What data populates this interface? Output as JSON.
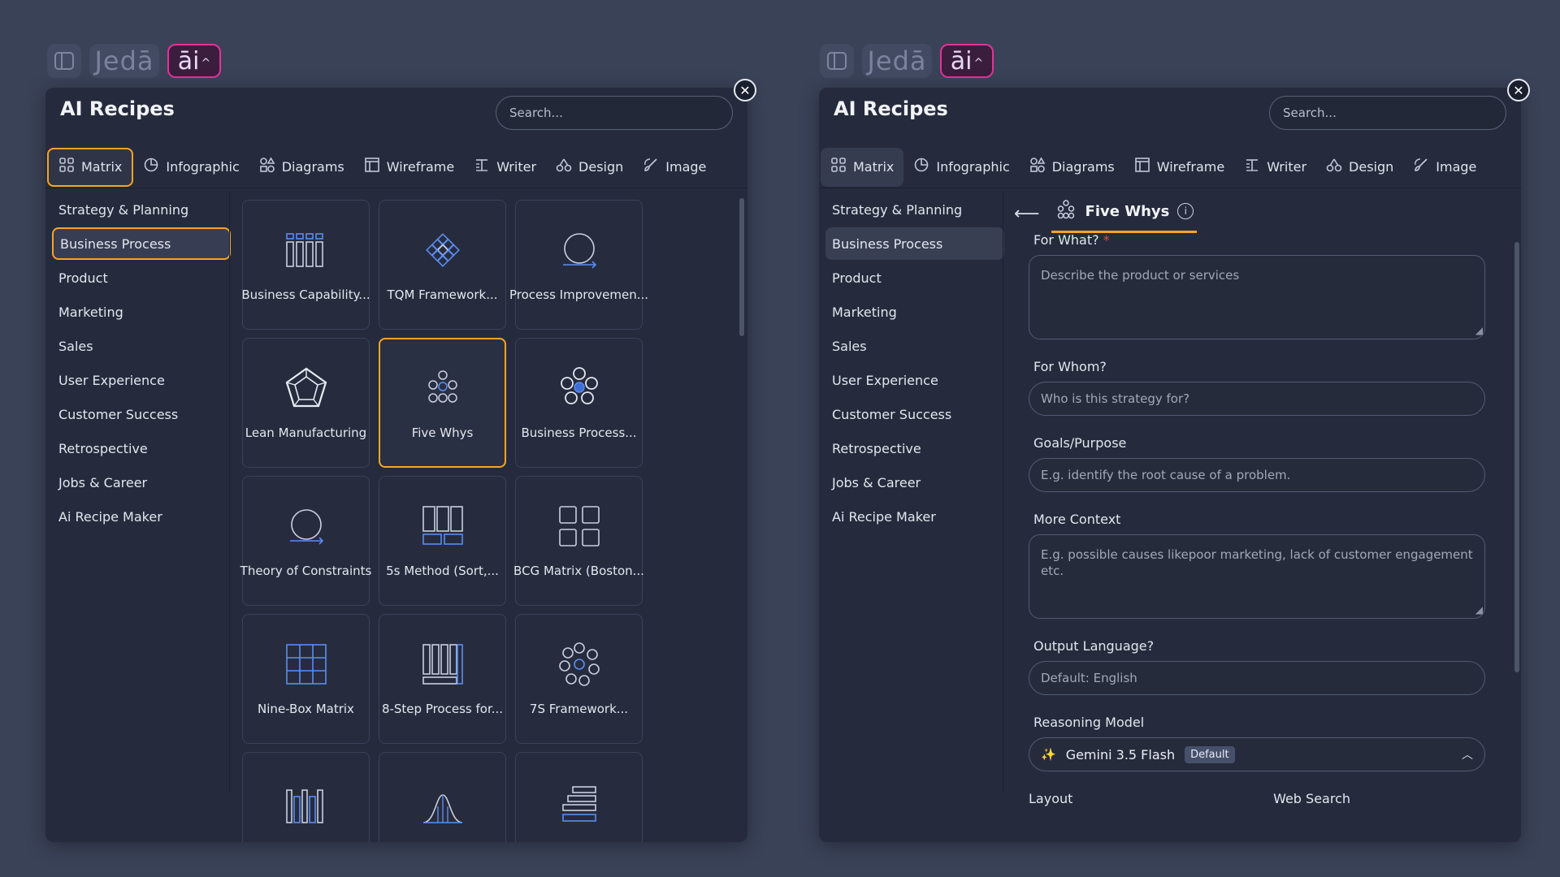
{
  "topbar": {
    "brand": "Jedā",
    "ai_label": "āi",
    "ai_chevron": "^"
  },
  "panel": {
    "title": "AI Recipes",
    "search_placeholder": "Search...",
    "close": "✕",
    "tabs": [
      {
        "label": "Matrix",
        "icon": "grid-icon"
      },
      {
        "label": "Infographic",
        "icon": "pie-chart-icon"
      },
      {
        "label": "Diagrams",
        "icon": "shapes-icon"
      },
      {
        "label": "Wireframe",
        "icon": "wireframe-icon"
      },
      {
        "label": "Writer",
        "icon": "text-icon"
      },
      {
        "label": "Design",
        "icon": "design-icon"
      },
      {
        "label": "Image",
        "icon": "brush-icon"
      }
    ],
    "categories": [
      "Strategy & Planning",
      "Business Process",
      "Product",
      "Marketing",
      "Sales",
      "User Experience",
      "Customer Success",
      "Retrospective",
      "Jobs & Career",
      "Ai Recipe Maker"
    ]
  },
  "recipes": [
    {
      "label": "Business Capability...",
      "icon": "columns-icon"
    },
    {
      "label": "TQM Framework...",
      "icon": "diamond-grid-icon"
    },
    {
      "label": "Process Improvemen...",
      "icon": "cycle-icon"
    },
    {
      "label": "Lean Manufacturing",
      "icon": "pentagon-icon"
    },
    {
      "label": "Five Whys",
      "icon": "circles-icon"
    },
    {
      "label": "Business Process...",
      "icon": "flower-icon"
    },
    {
      "label": "Theory of Constraints",
      "icon": "cycle-icon"
    },
    {
      "label": "5s Method (Sort,...",
      "icon": "blocks-icon"
    },
    {
      "label": "BCG Matrix (Boston...",
      "icon": "quad-grid-icon"
    },
    {
      "label": "Nine-Box Matrix",
      "icon": "nine-grid-icon"
    },
    {
      "label": "8-Step Process for...",
      "icon": "bars-icon"
    },
    {
      "label": "7S Framework...",
      "icon": "flower-icon"
    },
    {
      "label": "",
      "icon": "columns-icon"
    },
    {
      "label": "",
      "icon": "bell-curve-icon"
    },
    {
      "label": "",
      "icon": "stack-icon"
    }
  ],
  "form": {
    "back": "⟵",
    "title": "Five Whys",
    "info": "i",
    "for_what_label": "For What?",
    "required_mark": "*",
    "for_what_placeholder": "Describe the product or services",
    "for_whom_label": "For Whom?",
    "for_whom_placeholder": "Who is this strategy for?",
    "goals_label": "Goals/Purpose",
    "goals_placeholder": "E.g. identify the root cause of a problem.",
    "context_label": "More Context",
    "context_placeholder": "E.g. possible causes likepoor marketing, lack of customer engagement etc.",
    "language_label": "Output Language?",
    "language_placeholder": "Default: English",
    "model_label": "Reasoning Model",
    "model_name": "Gemini 3.5 Flash",
    "model_badge": "Default",
    "layout_label": "Layout",
    "web_search_label": "Web Search"
  },
  "colors": {
    "accent": "#f5a524",
    "ai_pink": "#e0349a",
    "panel_bg": "#252b3d",
    "page_bg": "#3a4258"
  }
}
